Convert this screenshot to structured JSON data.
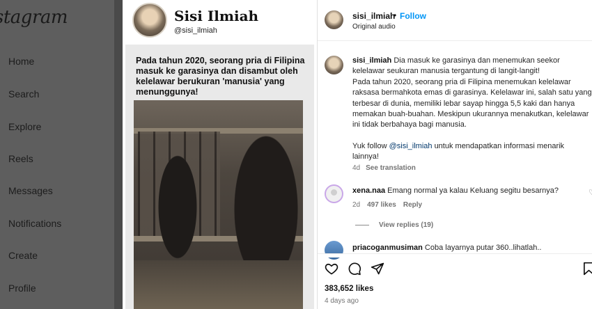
{
  "nav": {
    "logo": "Instagram",
    "items": [
      {
        "label": "Home"
      },
      {
        "label": "Search"
      },
      {
        "label": "Explore"
      },
      {
        "label": "Reels"
      },
      {
        "label": "Messages"
      },
      {
        "label": "Notifications"
      },
      {
        "label": "Create"
      },
      {
        "label": "Profile"
      }
    ]
  },
  "post_image": {
    "account_name": "Sisi Ilmiah",
    "account_handle": "@sisi_ilmiah",
    "headline": "Pada tahun 2020, seorang pria di Filipina masuk ke garasinya dan disambut oleh kelelawar berukuran 'manusia' yang menunggunya!"
  },
  "header": {
    "username": "sisi_ilmiah",
    "separator": "•",
    "follow_label": "Follow",
    "audio": "Original audio"
  },
  "caption": {
    "username": "sisi_ilmiah",
    "line1": "Dia masuk ke garasinya dan menemukan seekor kelelawar seukuran manusia tergantung di langit-langit!",
    "line2": "Pada tahun 2020, seorang pria di Filipina menemukan kelelawar raksasa bermahkota emas di garasinya. Kelelawar ini, salah satu yang terbesar di dunia, memiliki lebar sayap hingga 5,5 kaki dan hanya memakan buah-buahan. Meskipun ukurannya menakutkan, kelelawar ini tidak berbahaya bagi manusia.",
    "follow_prefix": "Yuk follow",
    "follow_mention": "@sisi_ilmiah",
    "follow_suffix": "untuk mendapatkan informasi menarik lainnya!",
    "age": "4d",
    "translate": "See translation"
  },
  "comments": [
    {
      "username": "xena.naa",
      "text": "Emang normal ya kalau Keluang segitu besarnya?",
      "age": "2d",
      "likes": "497 likes",
      "reply": "Reply",
      "view_replies": "View replies (19)"
    },
    {
      "username": "priacoganmusiman",
      "text": "Coba layarnya putar 360..lihatlah.."
    }
  ],
  "actions": {
    "like_icon": "heart-icon",
    "comment_icon": "comment-icon",
    "share_icon": "share-icon",
    "save_icon": "bookmark-icon"
  },
  "stats": {
    "likes": "383,652 likes",
    "posted": "4 days ago"
  },
  "colors": {
    "follow_blue": "#0095f6",
    "mention_blue": "#00376b"
  }
}
